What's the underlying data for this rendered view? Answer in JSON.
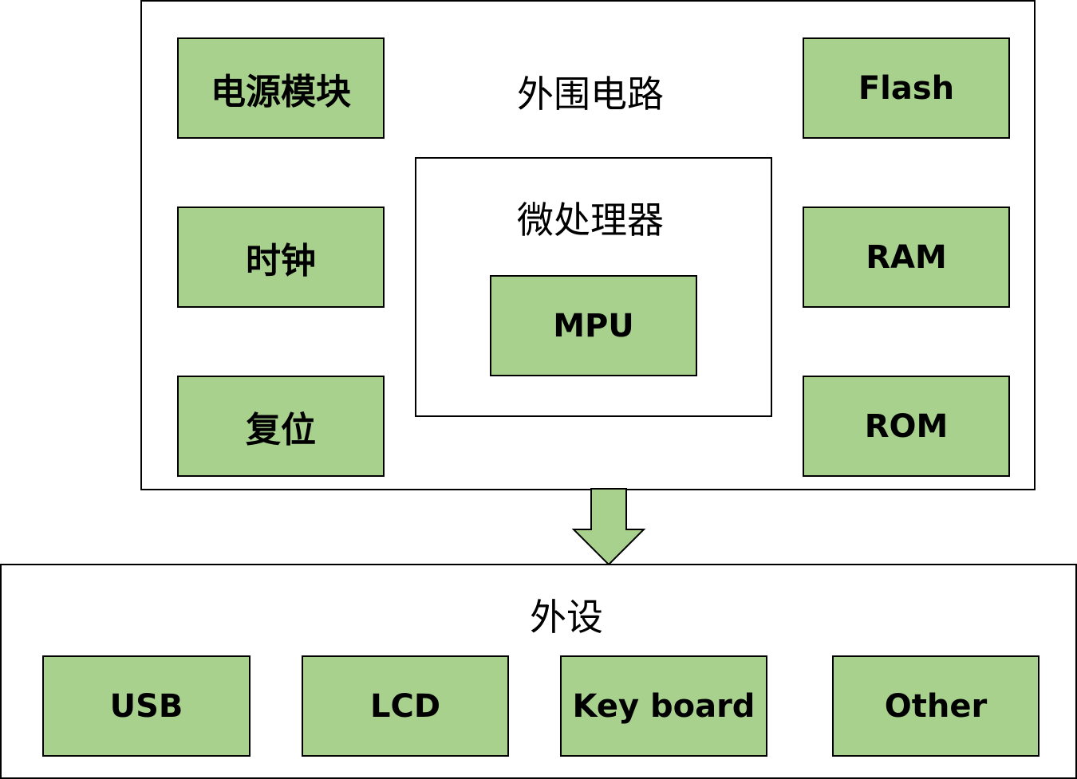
{
  "colors": {
    "box_fill": "#a9d18e",
    "stroke": "#000000",
    "background": "#ffffff"
  },
  "peripheral_circuit": {
    "title": "外围电路",
    "left_blocks": [
      "电源模块",
      "时钟",
      "复位"
    ],
    "right_blocks": [
      "Flash",
      "RAM",
      "ROM"
    ],
    "microprocessor": {
      "title": "微处理器",
      "core": "MPU"
    }
  },
  "arrow": {
    "direction": "down"
  },
  "peripherals": {
    "title": "外设",
    "blocks": [
      "USB",
      "LCD",
      "Key board",
      "Other"
    ]
  }
}
